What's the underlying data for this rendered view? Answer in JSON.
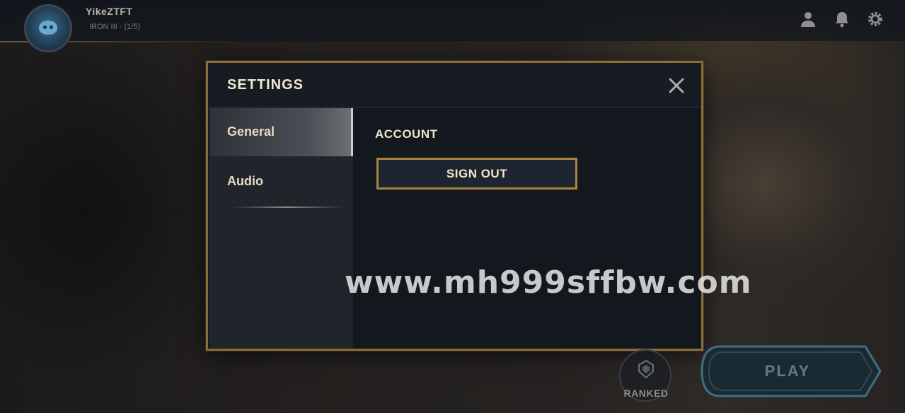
{
  "profile": {
    "username": "YikeZTFT",
    "rank": "IRON III · (1/5)"
  },
  "top_icons": [
    "profile-icon",
    "bell-icon",
    "gear-icon"
  ],
  "settings_modal": {
    "title": "SETTINGS",
    "close_icon": "close-icon",
    "tabs": [
      {
        "label": "General",
        "active": true
      },
      {
        "label": "Audio",
        "active": false
      }
    ],
    "section_title": "ACCOUNT",
    "sign_out_label": "SIGN OUT"
  },
  "bottom": {
    "ranked_label": "RANKED",
    "play_label": "PLAY"
  },
  "watermark": "www.mh999sffbw.com",
  "colors": {
    "accent_gold": "#a8843f",
    "modal_bg": "#161c22",
    "text_cream": "#efe5cc"
  }
}
